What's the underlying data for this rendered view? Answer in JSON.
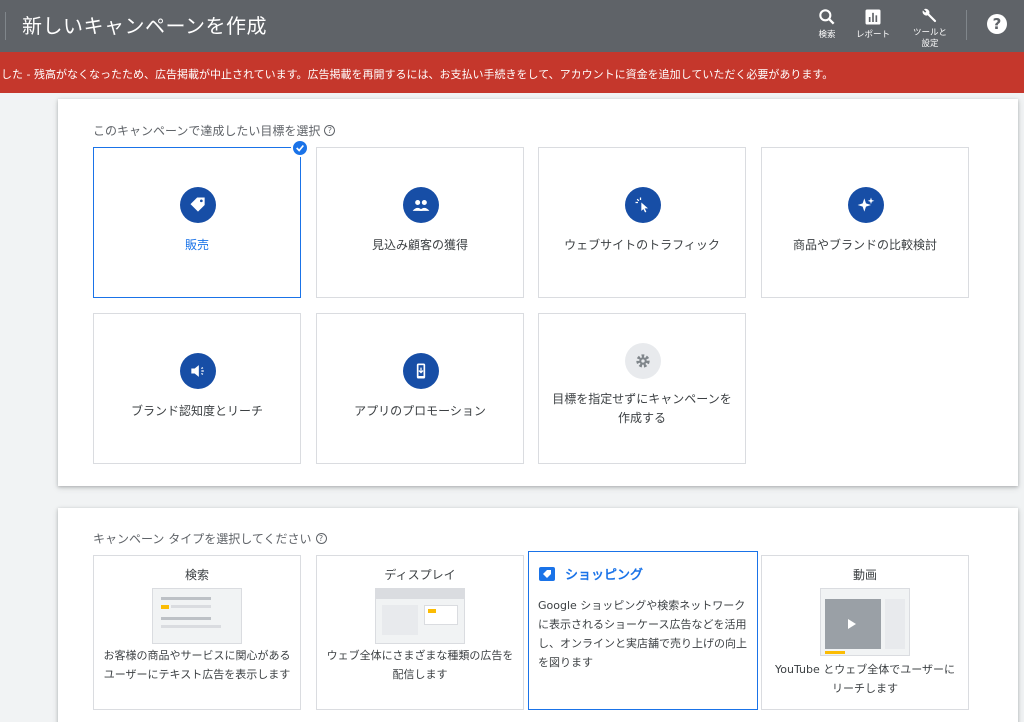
{
  "header": {
    "title": "新しいキャンペーンを作成",
    "actions": [
      {
        "label": "検索",
        "icon": "search-icon"
      },
      {
        "label": "レポート",
        "icon": "reports-icon"
      },
      {
        "label": "ツールと\n設定",
        "icon": "wrench-icon"
      }
    ],
    "help": "?"
  },
  "banner": {
    "text": "した - 残高がなくなったため、広告掲載が中止されています。広告掲載を再開するには、お支払い手続きをして、アカウントに資金を追加していただく必要があります。",
    "color": "#c5372c"
  },
  "goals": {
    "heading": "このキャンペーンで達成したい目標を選択",
    "items": [
      {
        "label": "販売",
        "icon": "tag-icon",
        "selected": true
      },
      {
        "label": "見込み顧客の獲得",
        "icon": "people-icon"
      },
      {
        "label": "ウェブサイトのトラフィック",
        "icon": "cursor-click-icon"
      },
      {
        "label": "商品やブランドの比較検討",
        "icon": "sparkle-icon"
      },
      {
        "label": "ブランド認知度とリーチ",
        "icon": "speaker-icon"
      },
      {
        "label": "アプリのプロモーション",
        "icon": "phone-download-icon"
      },
      {
        "label": "目標を指定せずにキャンペーンを作成する",
        "icon": "gear-icon"
      }
    ]
  },
  "types": {
    "heading": "キャンペーン タイプを選択してください",
    "items": [
      {
        "title": "検索",
        "desc": "お客様の商品やサービスに関心があるユーザーにテキスト広告を表示します"
      },
      {
        "title": "ディスプレイ",
        "desc": "ウェブ全体にさまざまな種類の広告を配信します"
      },
      {
        "title": "ショッピング",
        "desc": "Google ショッピングや検索ネットワークに表示されるショーケース広告などを活用し、オンラインと実店舗で売り上げの向上を図ります",
        "selected": true
      },
      {
        "title": "動画",
        "desc": "YouTube とウェブ全体でユーザーにリーチします"
      }
    ]
  },
  "colors": {
    "accent": "#1a73e8",
    "icon_circle": "#174ea6",
    "header": "#5f6368"
  }
}
